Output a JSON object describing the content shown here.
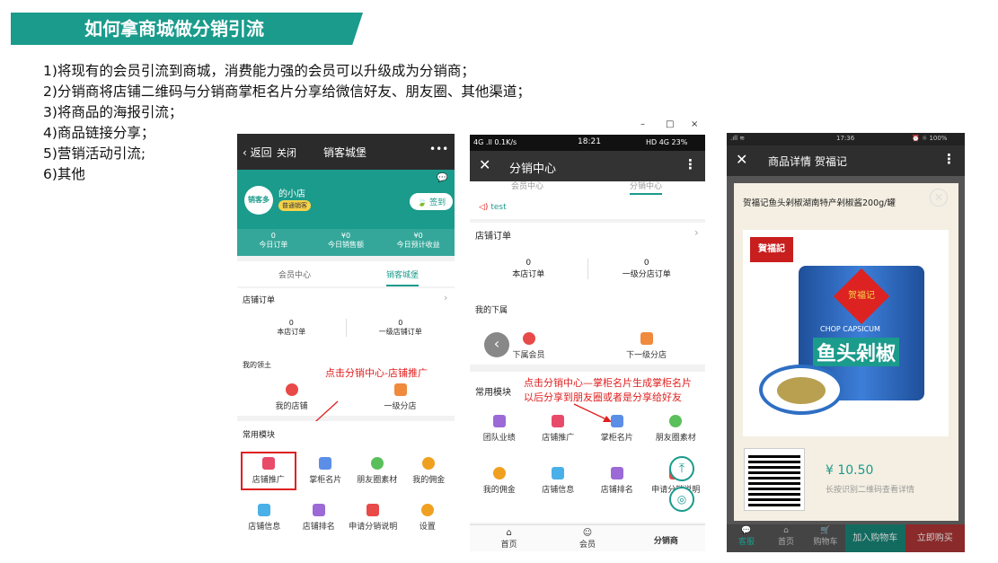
{
  "slide": {
    "title": "如何拿商城做分销引流",
    "bullets": [
      "1)将现有的会员引流到商城，消费能力强的会员可以升级成为分销商；",
      "2)分销商将店铺二维码与分销商掌柜名片分享给微信好友、朋友圈、其他渠道；",
      "3)将商品的海报引流；",
      "4)商品链接分享；",
      "5)营销活动引流;",
      "6)其他"
    ]
  },
  "phone1": {
    "back": "返回",
    "close": "关闭",
    "title": "销客城堡",
    "more": "•••",
    "shop_name": "的小店",
    "badge": "普通销客",
    "sign": "签到",
    "logo": "销客多",
    "stats": [
      {
        "v": "0",
        "l": "今日订单"
      },
      {
        "v": "¥0",
        "l": "今日销售额"
      },
      {
        "v": "¥0",
        "l": "今日预计收益"
      }
    ],
    "tabs": [
      "会员中心",
      "销客城堡"
    ],
    "orders_title": "店铺订单",
    "orders": [
      {
        "v": "0",
        "l": "本店订单"
      },
      {
        "v": "0",
        "l": "一级店铺订单"
      }
    ],
    "leader_title": "我的领土",
    "leaders": [
      "我的店铺",
      "一级分店"
    ],
    "annot": "点击分销中心-店铺推广",
    "modules_title": "常用模块",
    "modules": [
      "店铺推广",
      "掌柜名片",
      "朋友圈素材",
      "我的佣金",
      "店铺信息",
      "店铺排名",
      "申请分销说明",
      "设置"
    ]
  },
  "phone2": {
    "win_controls": [
      "–",
      "□",
      "×"
    ],
    "status_left": "4G .ll 0.1K/s",
    "time": "18:21",
    "status_right": "HD 4G 23%",
    "title": "分销中心",
    "partial_tabs": [
      "会员中心",
      "分销中心"
    ],
    "test": "test",
    "orders_title": "店铺订单",
    "orders": [
      {
        "v": "0",
        "l": "本店订单"
      },
      {
        "v": "0",
        "l": "一级分店订单"
      }
    ],
    "sub_title": "我的下属",
    "subs": [
      "下属会员",
      "下一级分店"
    ],
    "modules_title": "常用模块",
    "annot1": "点击分销中心—掌柜名片生成掌柜名片",
    "annot2": "以后分享到朋友圈或者是分享给好友",
    "modules": [
      "团队业绩",
      "店铺推广",
      "掌柜名片",
      "朋友圈素材",
      "我的佣金",
      "店铺信息",
      "店铺排名",
      "申请分销说明"
    ],
    "nav": [
      "首页",
      "会员",
      "分销商"
    ]
  },
  "phone3": {
    "status_left": ".ıll ≋",
    "time": "17:36",
    "status_right": "⏰ ☼ 100%",
    "title": "商品详情 贺福记",
    "product_name": "贺福记鱼头剁椒湖南特产剁椒酱200g/罐",
    "brand": "賀福記",
    "brand2": "贺福记",
    "can_chars": "鱼头剁椒",
    "can_en": "CHOP CAPSICUM",
    "price": "¥ 10.50",
    "qr_hint": "长按识别二维码查看详情",
    "bottom": [
      "客服",
      "首页",
      "购物车",
      "加入购物车",
      "立即购买"
    ]
  }
}
